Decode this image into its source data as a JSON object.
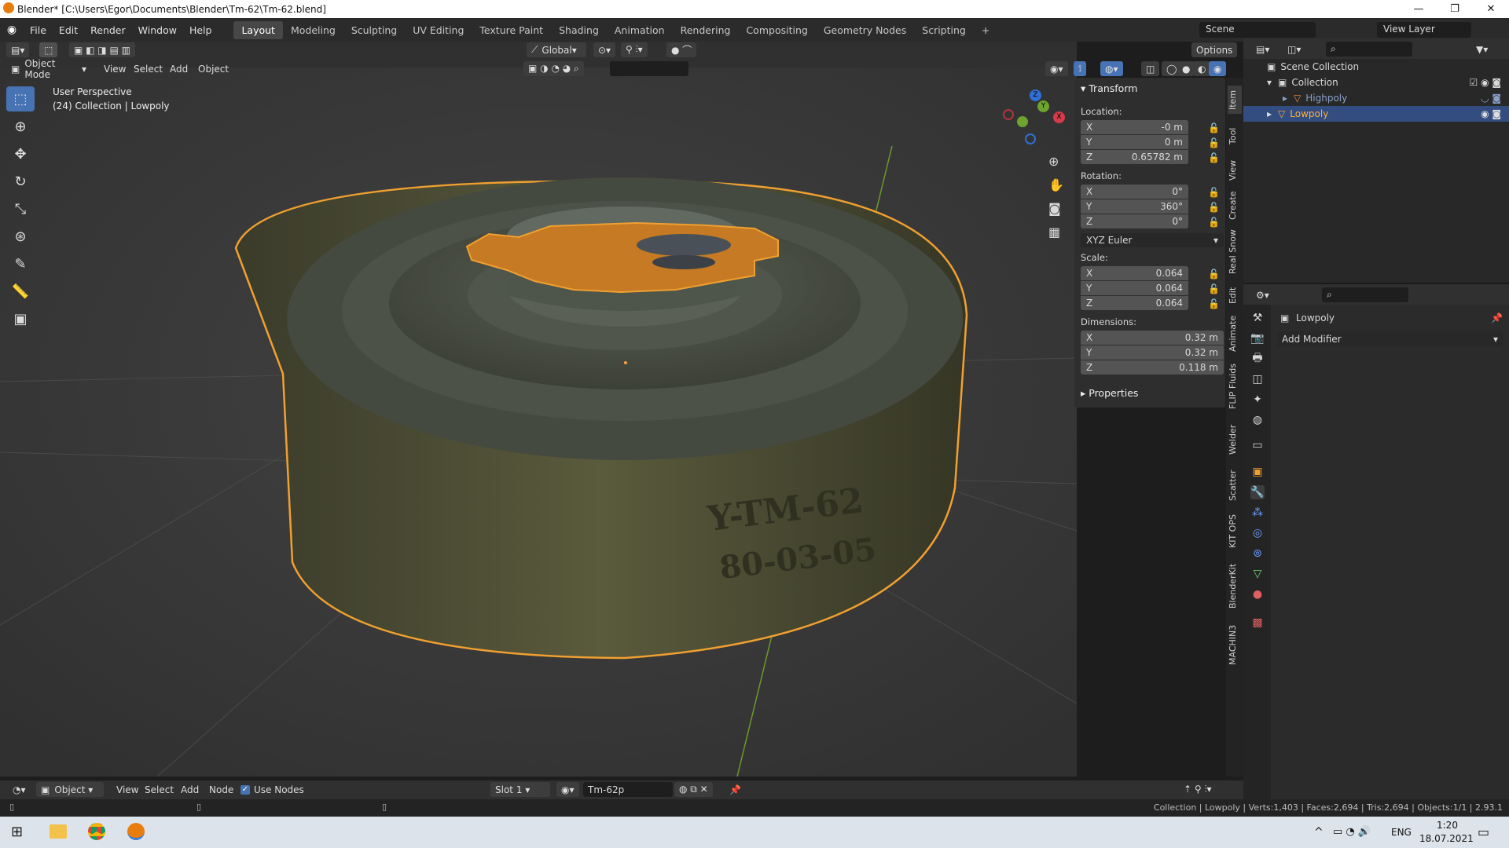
{
  "window": {
    "title": "Blender* [C:\\Users\\Egor\\Documents\\Blender\\Tm-62\\Tm-62.blend]",
    "minimize": "—",
    "maximize": "❐",
    "close": "✕"
  },
  "menu": [
    "File",
    "Edit",
    "Render",
    "Window",
    "Help"
  ],
  "workspaces": [
    "Layout",
    "Modeling",
    "Sculpting",
    "UV Editing",
    "Texture Paint",
    "Shading",
    "Animation",
    "Rendering",
    "Compositing",
    "Geometry Nodes",
    "Scripting"
  ],
  "workspace_add": "+",
  "scene": {
    "name": "Scene",
    "view_layer": "View Layer"
  },
  "viewport_header": {
    "mode": "Object Mode",
    "menus": [
      "View",
      "Select",
      "Add",
      "Object"
    ],
    "orientation": "Global",
    "options": "Options"
  },
  "viewport_overlay": {
    "perspective": "User Perspective",
    "collection": "(24) Collection | Lowpoly"
  },
  "mine_text": {
    "line1": "Y-TM-62",
    "line2": "80-03-05"
  },
  "gizmo": {
    "z": "Z",
    "y": "Y",
    "x": "X"
  },
  "npanel": {
    "transform_title": "Transform",
    "location_label": "Location:",
    "location": [
      {
        "axis": "X",
        "value": "-0 m"
      },
      {
        "axis": "Y",
        "value": "0 m"
      },
      {
        "axis": "Z",
        "value": "0.65782 m"
      }
    ],
    "rotation_label": "Rotation:",
    "rotation": [
      {
        "axis": "X",
        "value": "0°"
      },
      {
        "axis": "Y",
        "value": "360°"
      },
      {
        "axis": "Z",
        "value": "0°"
      }
    ],
    "rotation_mode": "XYZ Euler",
    "scale_label": "Scale:",
    "scale": [
      {
        "axis": "X",
        "value": "0.064"
      },
      {
        "axis": "Y",
        "value": "0.064"
      },
      {
        "axis": "Z",
        "value": "0.064"
      }
    ],
    "dimensions_label": "Dimensions:",
    "dimensions": [
      {
        "axis": "X",
        "value": "0.32 m"
      },
      {
        "axis": "Y",
        "value": "0.32 m"
      },
      {
        "axis": "Z",
        "value": "0.118 m"
      }
    ],
    "properties_title": "Properties"
  },
  "side_tabs": [
    "Item",
    "Tool",
    "View",
    "Create",
    "Real Snow",
    "Edit",
    "Animate",
    "FLIP Fluids",
    "Welder",
    "Scatter",
    "KIT OPS",
    "BlenderKit",
    "MACHIN3"
  ],
  "outliner": {
    "root": "Scene Collection",
    "collection": "Collection",
    "items": [
      "Highpoly",
      "Lowpoly"
    ]
  },
  "properties": {
    "object_name": "Lowpoly",
    "add_modifier": "Add Modifier"
  },
  "node_header": {
    "type": "Object",
    "menus": [
      "View",
      "Select",
      "Add",
      "Node"
    ],
    "use_nodes": "Use Nodes",
    "slot": "Slot 1",
    "material": "Tm-62p"
  },
  "status": "Collection | Lowpoly | Verts:1,403 | Faces:2,694 | Tris:2,694 | Objects:1/1 | 2.93.1",
  "taskbar": {
    "lang": "ENG",
    "time": "1:20",
    "date": "18.07.2021",
    "caret": "^"
  },
  "colors": {
    "accent": "#4772b3",
    "selection": "#f0a030",
    "mine_body": "#4e5034"
  }
}
